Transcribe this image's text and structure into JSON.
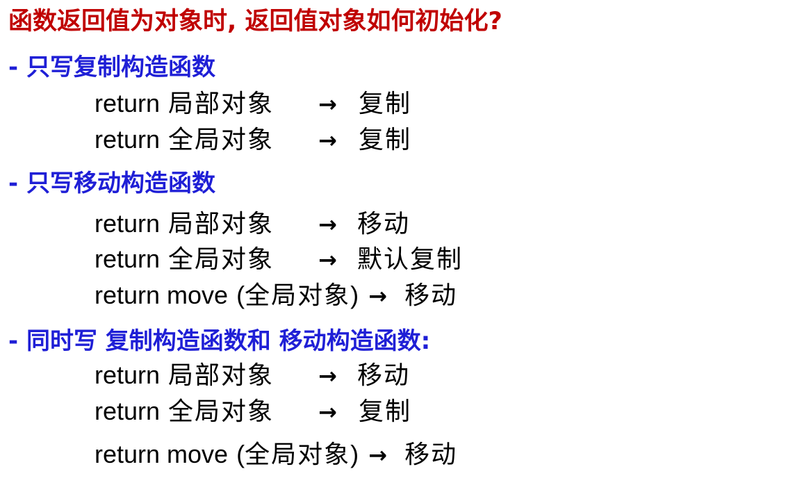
{
  "title": "函数返回值为对象时, 返回值对象如何初始化?",
  "sections": [
    {
      "heading": "- 只写复制构造函数",
      "lines": [
        {
          "code": "return",
          "object": "局部对象",
          "arrow": "→",
          "result": "复制"
        },
        {
          "code": "return",
          "object": "全局对象",
          "arrow": "→",
          "result": "复制"
        }
      ]
    },
    {
      "heading": "- 只写移动构造函数",
      "lines": [
        {
          "code": "return",
          "object": "局部对象",
          "arrow": "→",
          "result": "移动"
        },
        {
          "code": "return",
          "object": "全局对象",
          "arrow": "→",
          "result": "默认复制"
        },
        {
          "code": "return move",
          "open_paren": "(",
          "object": "全局对象",
          "close_paren": ")",
          "arrow": "→",
          "result": "移动"
        }
      ]
    },
    {
      "heading": "- 同时写 复制构造函数和 移动构造函数:",
      "lines": [
        {
          "code": "return",
          "object": "局部对象",
          "arrow": "→",
          "result": "移动"
        },
        {
          "code": "return",
          "object": "全局对象",
          "arrow": "→",
          "result": "复制"
        },
        {
          "code": "return move",
          "open_paren": "(",
          "object": "全局对象",
          "close_paren": ")",
          "arrow": "→",
          "result": "移动"
        }
      ]
    }
  ]
}
